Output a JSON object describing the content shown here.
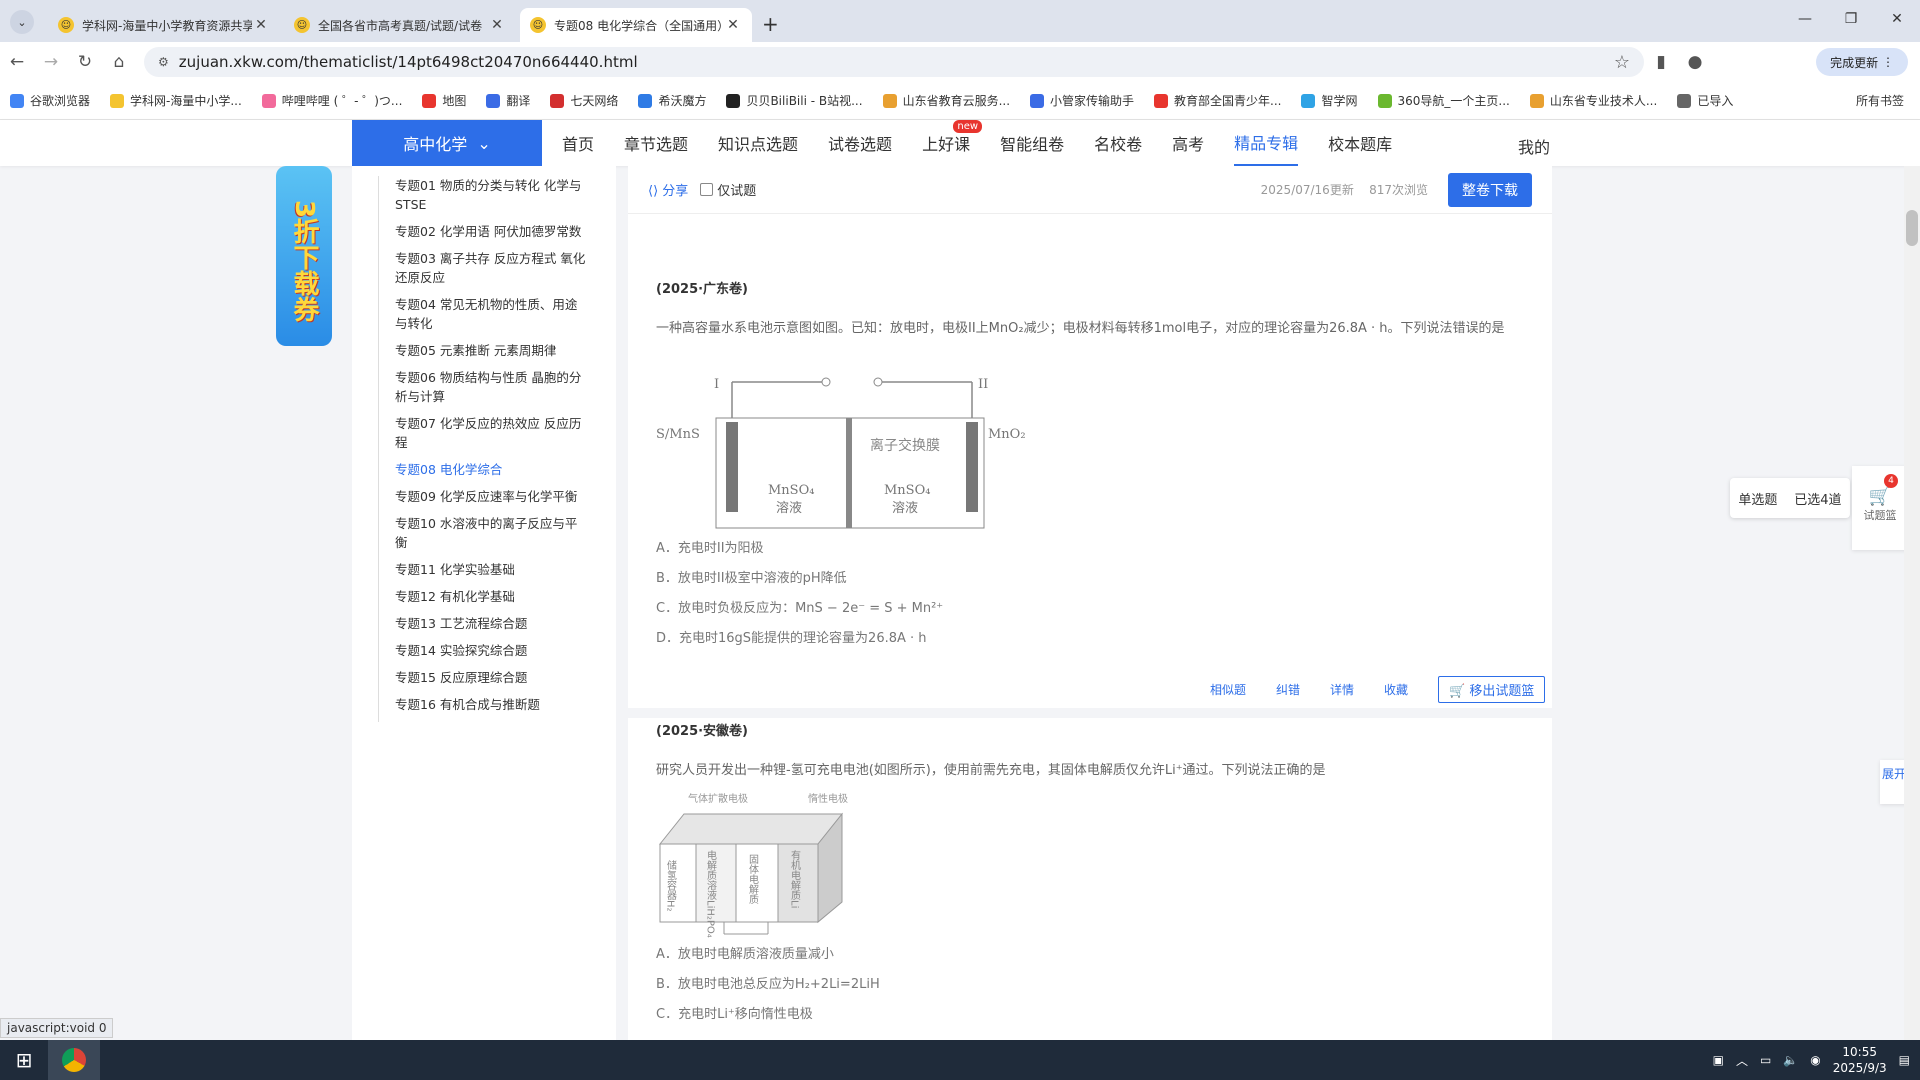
{
  "browser": {
    "tabs": [
      {
        "title": "学科网-海量中小学教育资源共享"
      },
      {
        "title": "全国各省市高考真题/试题/试卷"
      },
      {
        "title": "专题08 电化学综合（全国通用）"
      }
    ],
    "url": "zujuan.xkw.com/thematiclist/14pt6498ct20470n664440.html",
    "update_label": "完成更新",
    "bookmarks": [
      "谷歌浏览器",
      "学科网-海量中小学...",
      "哔哩哔哩 ( ゜- ゜)つ...",
      "地图",
      "翻译",
      "七天网络",
      "希沃魔方",
      "贝贝BiliBili - B站视...",
      "山东省教育云服务...",
      "小管家传输助手",
      "教育部全国青少年...",
      "智学网",
      "360导航_一个主页...",
      "山东省专业技术人...",
      "已导入"
    ],
    "all_bookmarks": "所有书签"
  },
  "site": {
    "subject": "高中化学",
    "nav": [
      "首页",
      "章节选题",
      "知识点选题",
      "试卷选题",
      "上好课",
      "智能组卷",
      "名校卷",
      "高考",
      "精品专辑",
      "校本题库"
    ],
    "new_badge": "new",
    "mine": "我的",
    "promo": "3折下载券"
  },
  "toc": [
    "专题01 物质的分类与转化 化学与STSE",
    "专题02 化学用语 阿伏加德罗常数",
    "专题03 离子共存 反应方程式 氧化还原反应",
    "专题04 常见无机物的性质、用途与转化",
    "专题05 元素推断 元素周期律",
    "专题06 物质结构与性质 晶胞的分析与计算",
    "专题07 化学反应的热效应 反应历程",
    "专题08 电化学综合",
    "专题09 化学反应速率与化学平衡",
    "专题10 水溶液中的离子反应与平衡",
    "专题11 化学实验基础",
    "专题12 有机化学基础",
    "专题13 工艺流程综合题",
    "专题14 实验探究综合题",
    "专题15 反应原理综合题",
    "专题16 有机合成与推断题"
  ],
  "toolbar": {
    "share": "分享",
    "only_questions": "仅试题",
    "updated": "2025/07/16更新",
    "views": "817次浏览",
    "download": "整卷下载"
  },
  "q1": {
    "source": "(2025·广东卷)",
    "stem": "一种高容量水系电池示意图如图。已知：放电时，电极II上MnO₂减少；电极材料每转移1mol电子，对应的理论容量为26.8A · h。下列说法错误的是",
    "diagram": {
      "label_left": "S/MnS",
      "label_i": "I",
      "label_ii": "II",
      "label_right": "MnO₂",
      "membrane": "离子交换膜",
      "sol_left": "MnSO₄",
      "sol_left2": "溶液",
      "sol_right": "MnSO₄",
      "sol_right2": "溶液"
    },
    "options": [
      "A．充电时II为阳极",
      "B．放电时II极室中溶液的pH降低",
      "C．放电时负极反应为：MnS − 2e⁻ = S + Mn²⁺",
      "D．充电时16gS能提供的理论容量为26.8A · h"
    ],
    "actions": [
      "相似题",
      "纠错",
      "详情",
      "收藏"
    ],
    "remove": "移出试题篮"
  },
  "q2": {
    "source": "(2025·安徽卷)",
    "stem": "研究人员开发出一种锂-氢可充电电池(如图所示)，使用前需先充电，其固体电解质仅允许Li⁺通过。下列说法正确的是",
    "diagram": {
      "top_left": "气体扩散电极",
      "top_right": "惰性电极",
      "c1": "储氢容器H₂",
      "c2": "电解质溶液LiH₂PO₄",
      "c3": "固体电解质",
      "c4": "有机电解质Li"
    },
    "options": [
      "A．放电时电解质溶液质量减小",
      "B．放电时电池总反应为H₂+2Li=2LiH",
      "C．充电时Li⁺移向惰性电极"
    ]
  },
  "basket": {
    "single": "单选题",
    "selected": "已选4道",
    "count": "4",
    "label": "试题篮",
    "expand": "展开"
  },
  "status": "javascript:void 0",
  "clock": {
    "time": "10:55",
    "date": "2025/9/3"
  }
}
